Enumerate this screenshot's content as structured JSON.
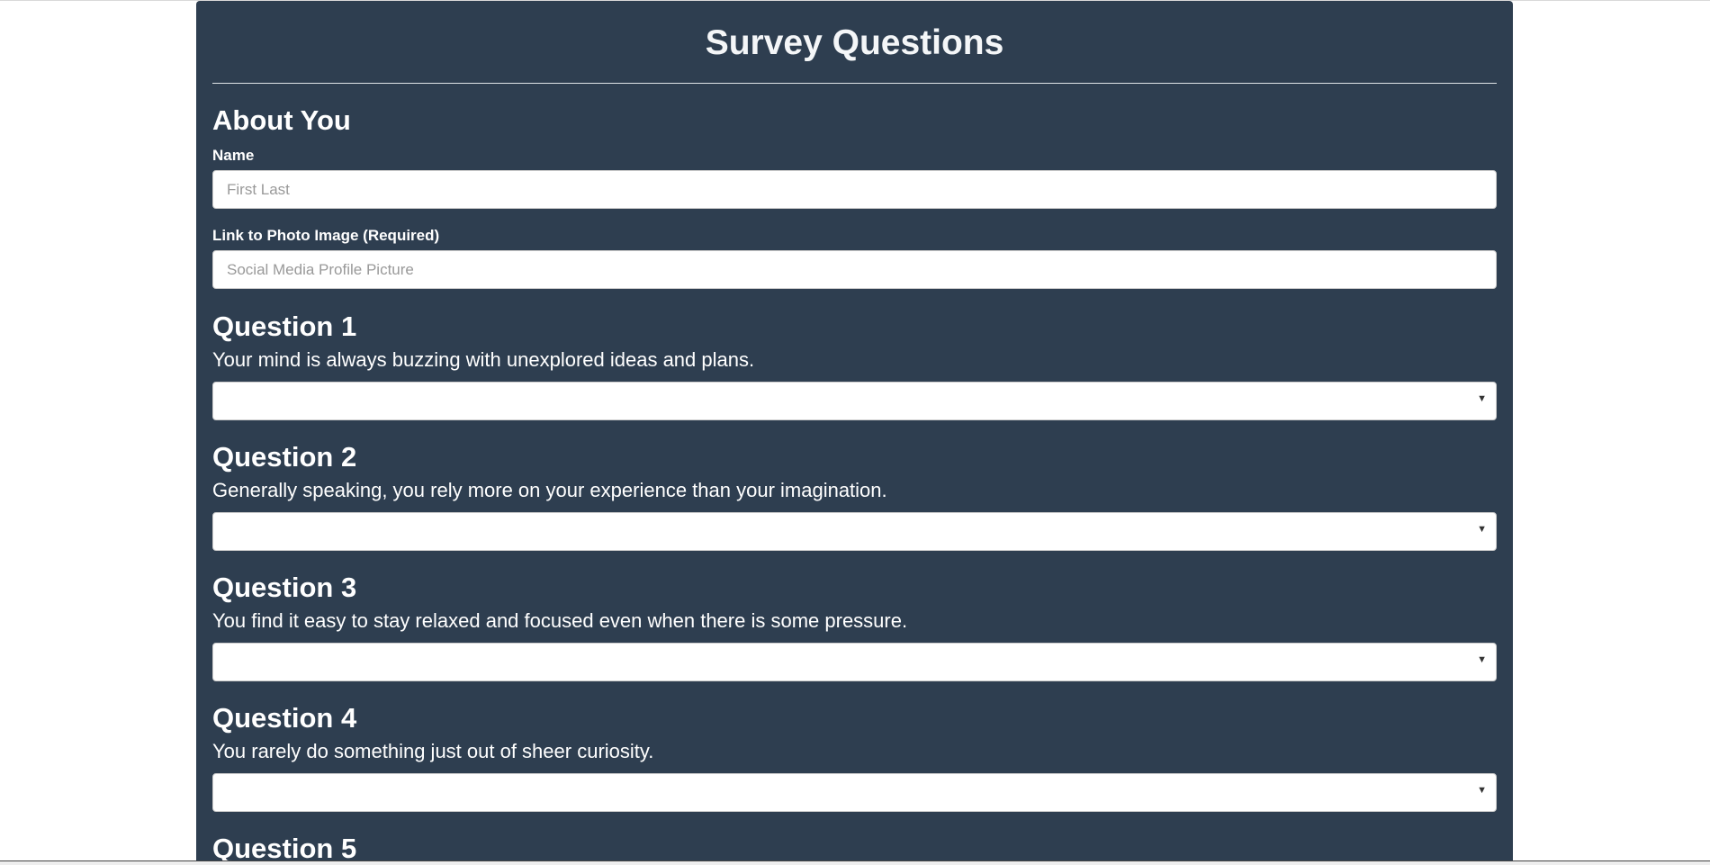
{
  "page": {
    "title": "Survey Questions"
  },
  "about": {
    "heading": "About You",
    "name_label": "Name",
    "name_placeholder": "First Last",
    "name_value": "",
    "photo_label": "Link to Photo Image (Required)",
    "photo_placeholder": "Social Media Profile Picture",
    "photo_value": ""
  },
  "questions": [
    {
      "heading": "Question 1",
      "text": "Your mind is always buzzing with unexplored ideas and plans.",
      "selected": ""
    },
    {
      "heading": "Question 2",
      "text": "Generally speaking, you rely more on your experience than your imagination.",
      "selected": ""
    },
    {
      "heading": "Question 3",
      "text": "You find it easy to stay relaxed and focused even when there is some pressure.",
      "selected": ""
    },
    {
      "heading": "Question 4",
      "text": "You rarely do something just out of sheer curiosity.",
      "selected": ""
    },
    {
      "heading": "Question 5"
    }
  ],
  "icons": {
    "dropdown": "chevron-down-icon"
  },
  "colors": {
    "panel_background": "#2e3e50",
    "page_background": "#ffffff",
    "text": "#ffffff",
    "input_background": "#ffffff"
  }
}
